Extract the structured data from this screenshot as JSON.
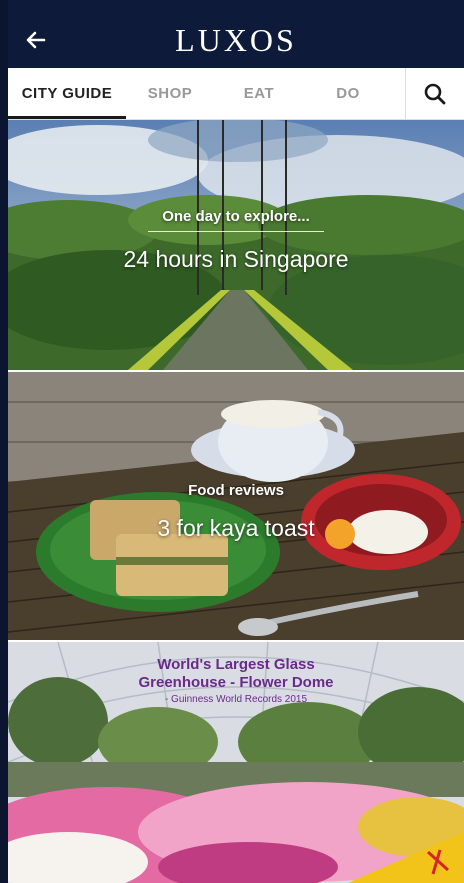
{
  "app": {
    "logo": "LUXOS"
  },
  "tabs": [
    {
      "label": "CITY GUIDE"
    },
    {
      "label": "SHOP"
    },
    {
      "label": "EAT"
    },
    {
      "label": "DO"
    }
  ],
  "cards": [
    {
      "kicker": "One day to explore...",
      "title": "24 hours in Singapore"
    },
    {
      "kicker": "Food reviews",
      "title": "3 for kaya toast"
    },
    {
      "badge_line1": "World's Largest Glass",
      "badge_line2": "Greenhouse - Flower Dome",
      "badge_line3": "- Guinness World Records 2015"
    }
  ],
  "colors": {
    "topbar": "#0d1a3a",
    "active_tab_text": "#222222",
    "inactive_tab_text": "#999999",
    "badge_purple": "#6a2a8a"
  },
  "icons": {
    "back": "arrow-left-icon",
    "search": "search-icon"
  }
}
